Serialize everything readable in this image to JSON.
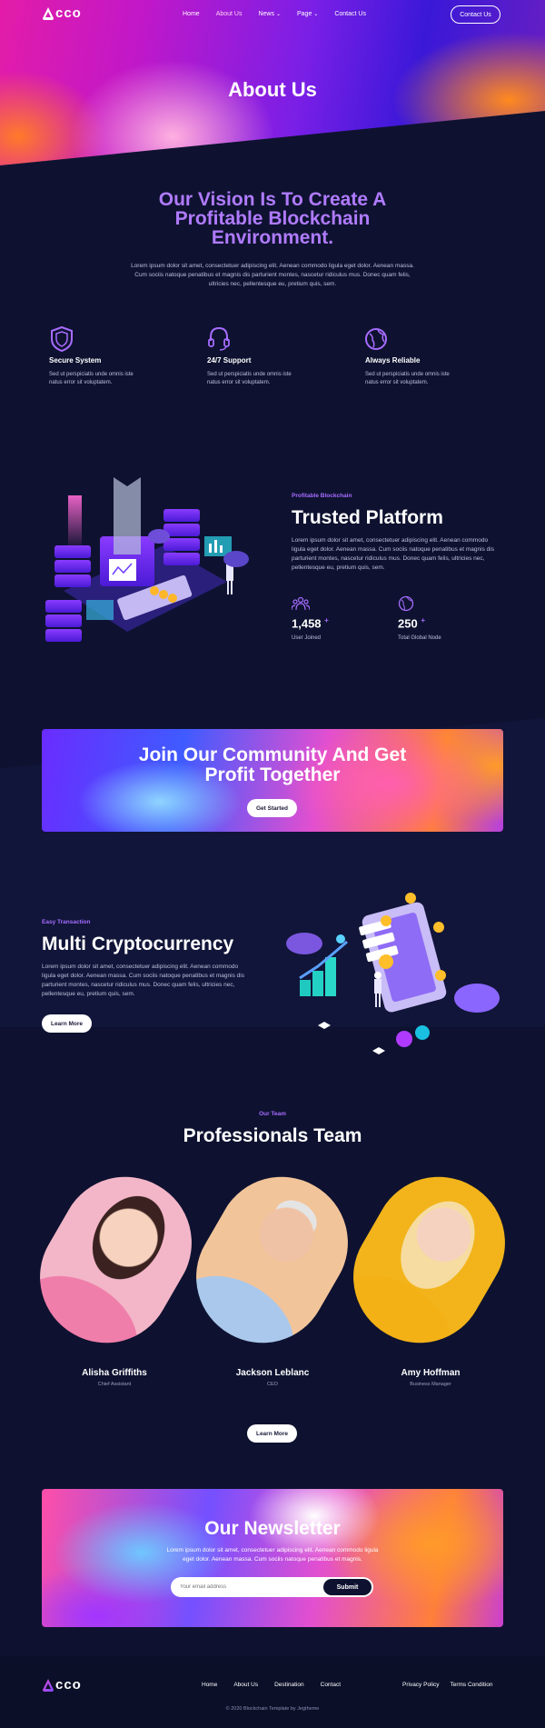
{
  "header": {
    "logo_text": "cco",
    "nav": [
      "Home",
      "About Us",
      "News",
      "Page",
      "Contact Us"
    ],
    "contact_button": "Contact Us"
  },
  "hero": {
    "title": "About Us"
  },
  "vision": {
    "title_line1": "Our Vision Is To Create A",
    "title_line2": "Profitable Blockchain",
    "title_line3": "Environment.",
    "text_line1": "Lorem ipsum dolor sit amet, consectetuer adipiscing elit. Aenean commodo ligula eget dolor. Aenean massa.",
    "text_line2": "Cum sociis natoque penatibus et magnis dis parturient montes, nascetur ridiculus mus. Donec quam felis,",
    "text_line3": "ultricies nec, pellentesque eu, pretium quis, sem."
  },
  "features": [
    {
      "title": "Secure System",
      "text_line1": "Sed ut perspiciatis unde omnis iste",
      "text_line2": "natus error sit voluptatem.",
      "icon": "shield-icon"
    },
    {
      "title": "24/7 Support",
      "text_line1": "Sed ut perspiciatis unde omnis iste",
      "text_line2": "natus error sit voluptatem.",
      "icon": "headset-icon"
    },
    {
      "title": "Always Reliable",
      "text_line1": "Sed ut perspiciatis unde omnis iste",
      "text_line2": "natus error sit voluptatem.",
      "icon": "globe-icon"
    }
  ],
  "platform": {
    "eyebrow": "Profitable Blockchain",
    "title": "Trusted Platform",
    "text_line1": "Lorem ipsum dolor sit amet, consectetuer adipiscing elit. Aenean commodo",
    "text_line2": "ligula eget dolor. Aenean massa. Cum sociis natoque penatibus et magnis dis",
    "text_line3": "parturient montes, nascetur ridiculus mus. Donec quam felis, ultricies nec,",
    "text_line4": "pellentesque eu, pretium quis, sem.",
    "stats": [
      {
        "value": "1,458",
        "plus": "+",
        "label": "User Joined",
        "icon": "users-icon"
      },
      {
        "value": "250",
        "plus": "+",
        "label": "Total Global Node",
        "icon": "globe-icon"
      }
    ]
  },
  "community": {
    "title_line1": "Join Our Community And Get",
    "title_line2": "Profit Together",
    "button": "Get Started"
  },
  "crypto": {
    "eyebrow": "Easy Transaction",
    "title": "Multi Cryptocurrency",
    "text_line1": "Lorem ipsum dolor sit amet, consectetuer adipiscing elit. Aenean commodo",
    "text_line2": "ligula eget dolor. Aenean massa. Cum sociis natoque penatibus et magnis dis",
    "text_line3": "parturient montes, nascetur ridiculus mus. Donec quam felis, ultricies nec,",
    "text_line4": "pellentesque eu, pretium quis, sem.",
    "button": "Learn More"
  },
  "team": {
    "eyebrow": "Our Team",
    "title": "Professionals Team",
    "members": [
      {
        "name": "Alisha Griffiths",
        "role": "Chief Assistant"
      },
      {
        "name": "Jackson Leblanc",
        "role": "CEO"
      },
      {
        "name": "Amy Hoffman",
        "role": "Business Manager"
      }
    ],
    "button": "Learn More"
  },
  "newsletter": {
    "title": "Our Newsletter",
    "text_line1": "Lorem ipsum dolor sit amet, consectetuer adipiscing elit. Aenean commodo ligula",
    "text_line2": "eget dolor. Aenean massa. Cum sociis natoque penatibus et magnis.",
    "placeholder": "Your email address",
    "button": "Submit"
  },
  "footer": {
    "logo_text": "cco",
    "links": [
      "Home",
      "About Us",
      "Destination",
      "Contact"
    ],
    "legal": [
      "Privacy Policy",
      "Terms Condition"
    ],
    "copyright": "© 2020 Blockchain Template by Jegtheme"
  },
  "colors": {
    "accent": "#b07bff",
    "background": "#0e1230",
    "dark_button": "#0e1230"
  }
}
